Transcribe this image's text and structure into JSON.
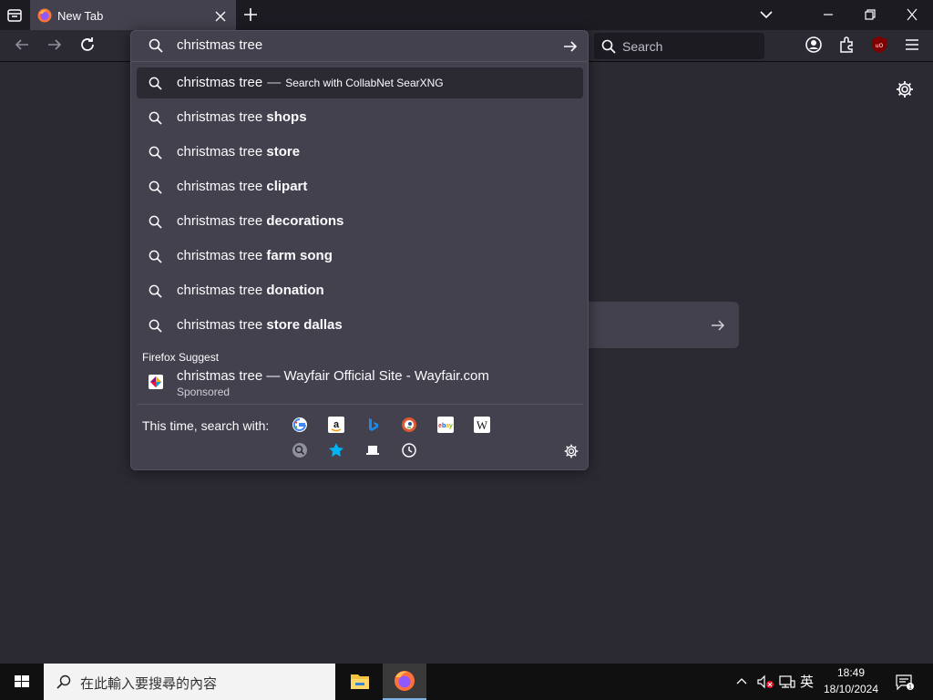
{
  "browser": {
    "tab": {
      "title": "New Tab"
    },
    "navbar": {
      "search_placeholder": "Search"
    }
  },
  "urlbar": {
    "input_value": "christmas tree",
    "heuristic": {
      "query": "christmas tree",
      "dash": "—",
      "engine_text": "Search with CollabNet SearXNG"
    },
    "suggestions": [
      {
        "prefix": "christmas tree",
        "completion": "shops"
      },
      {
        "prefix": "christmas tree",
        "completion": "store"
      },
      {
        "prefix": "christmas tree",
        "completion": "clipart"
      },
      {
        "prefix": "christmas tree",
        "completion": "decorations"
      },
      {
        "prefix": "christmas tree",
        "completion": "farm song"
      },
      {
        "prefix": "christmas tree",
        "completion": "donation"
      },
      {
        "prefix": "christmas tree",
        "completion": "store dallas"
      }
    ],
    "firefox_suggest": {
      "label": "Firefox Suggest",
      "title": "christmas tree — Wayfair Official Site - Wayfair.com",
      "sponsored": "Sponsored"
    },
    "oneoff": {
      "label": "This time, search with:",
      "engines": [
        "google-icon",
        "amazon-icon",
        "bing-icon",
        "duckduckgo-icon",
        "ebay-icon",
        "wikipedia-icon",
        "searxng-icon",
        "bookmarks-icon",
        "tabs-icon",
        "history-icon"
      ]
    }
  },
  "taskbar": {
    "search_placeholder": "在此輸入要搜尋的內容",
    "ime": "英",
    "time": "18:49",
    "date": "18/10/2024"
  },
  "colors": {
    "accent": "#7fb2e5",
    "background": "#2b2a33",
    "panel": "#42414d"
  }
}
